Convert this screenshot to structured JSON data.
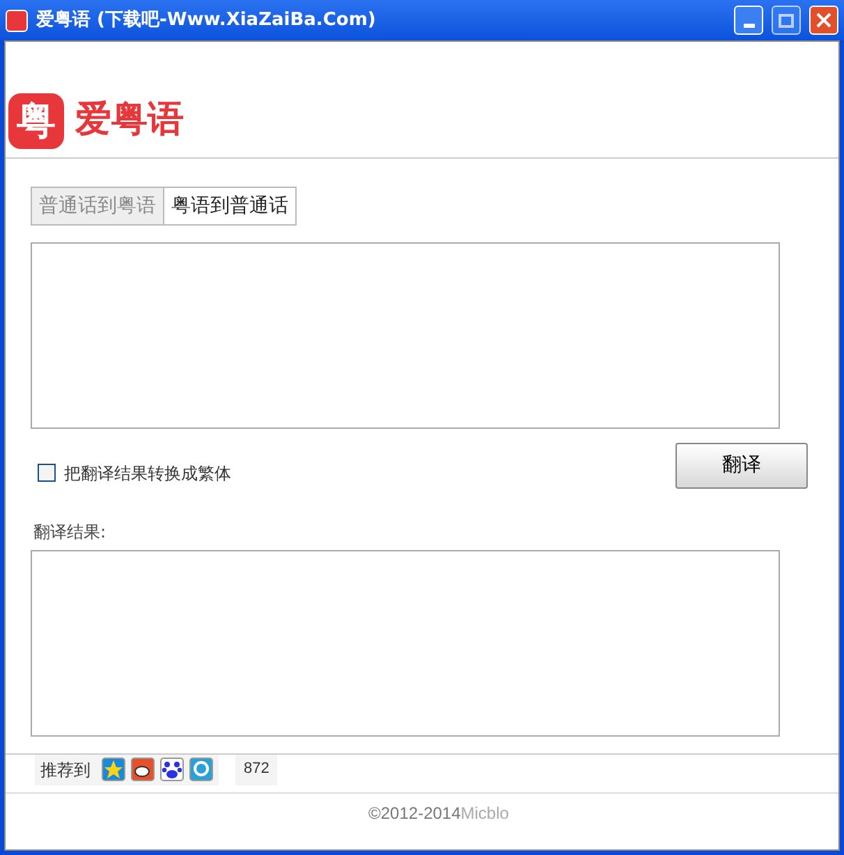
{
  "window": {
    "title": "爱粤语 (下载吧-Www.XiaZaiBa.Com)"
  },
  "logo": {
    "mark": "粤",
    "name": "爱粤语"
  },
  "tabs": [
    {
      "label": "普通话到粤语",
      "selected": false
    },
    {
      "label": "粤语到普通话",
      "selected": true
    }
  ],
  "option": {
    "label": "把翻译结果转换成繁体",
    "checked": false
  },
  "translate_button": "翻译",
  "result_label": "翻译结果:",
  "share": {
    "label": "推荐到",
    "count": "872"
  },
  "footer": {
    "years": "©2012-2014",
    "author": "Micblo"
  }
}
